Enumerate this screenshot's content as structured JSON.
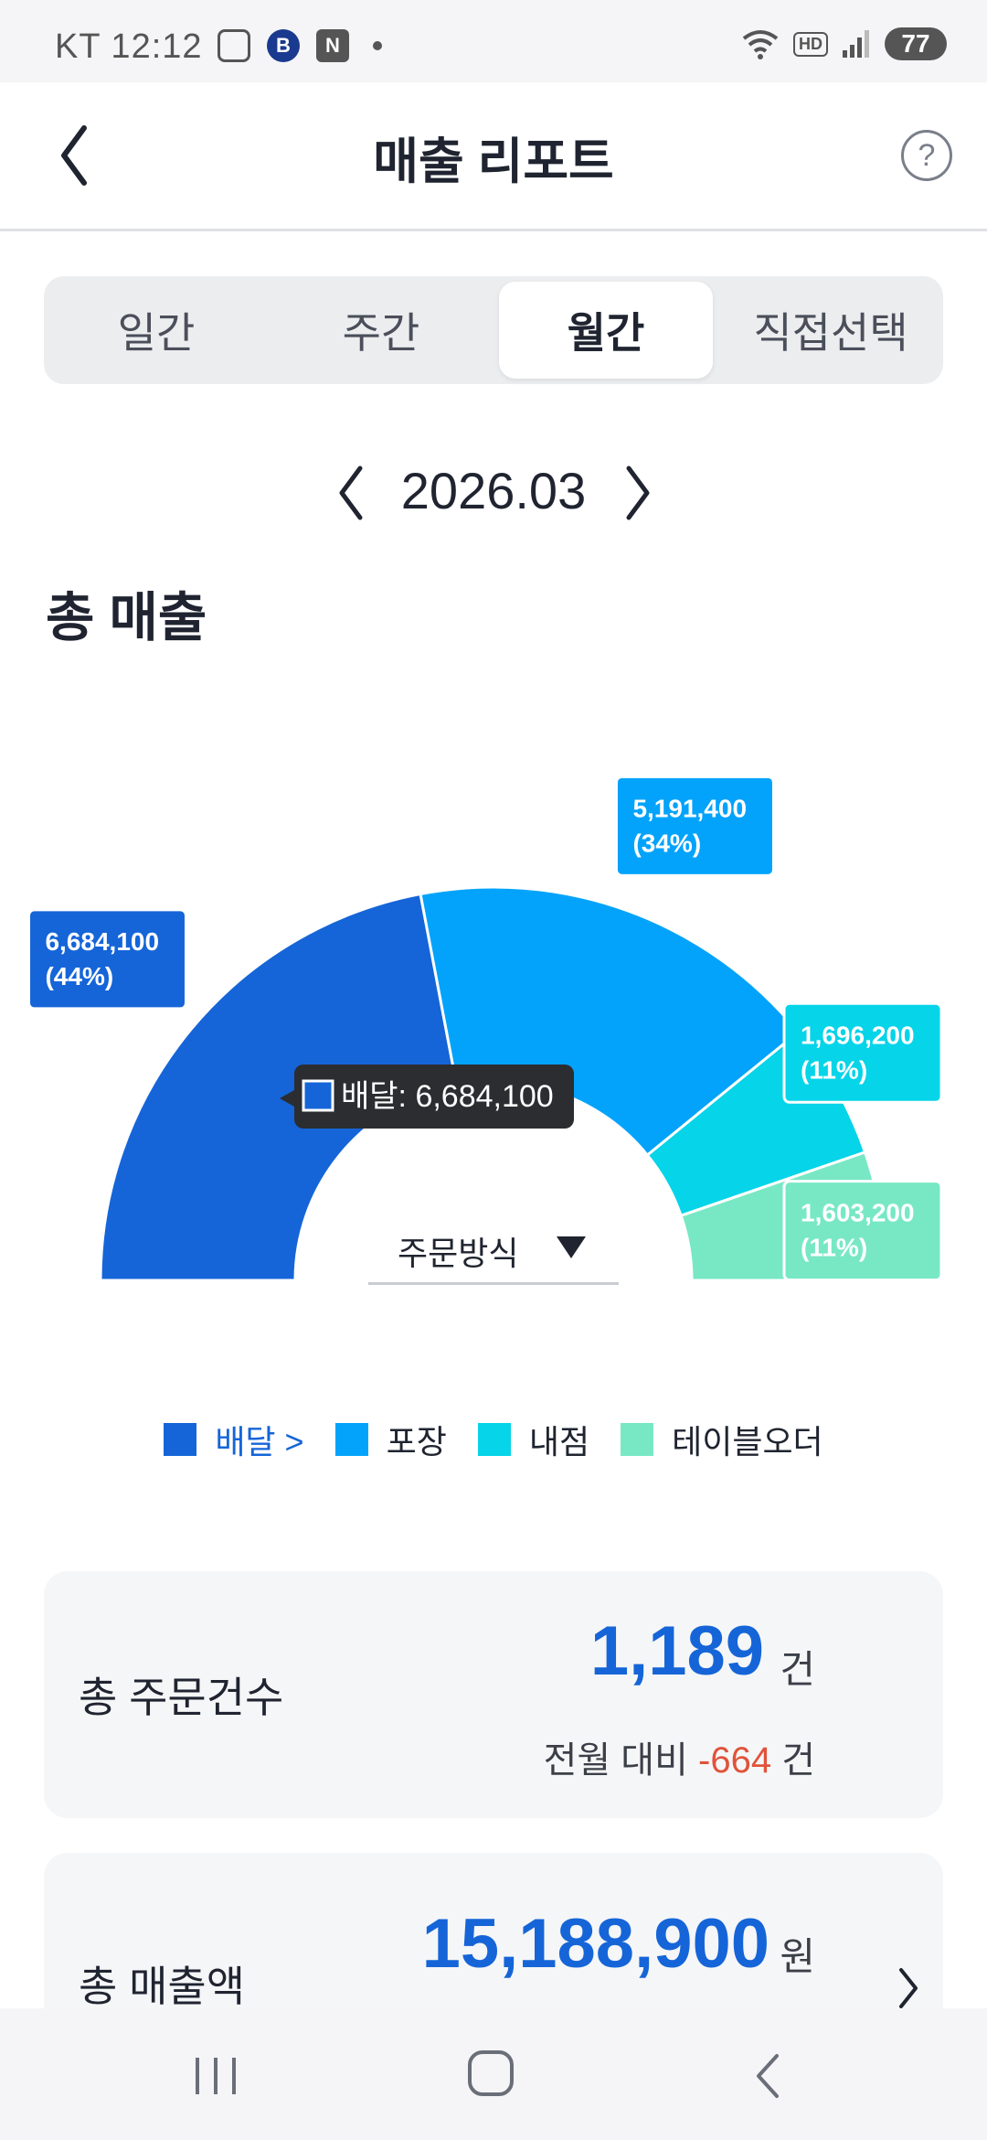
{
  "status_bar": {
    "carrier_time": "KT 12:12",
    "app_icon_text": "B",
    "n_icon_text": "N",
    "hd": "HD",
    "battery": "77"
  },
  "header": {
    "title": "매출 리포트",
    "help": "?"
  },
  "tabs": [
    {
      "label": "일간",
      "active": false
    },
    {
      "label": "주간",
      "active": false
    },
    {
      "label": "월간",
      "active": true
    },
    {
      "label": "직접선택",
      "active": false
    }
  ],
  "date": {
    "label": "2026.03"
  },
  "section_title": "총 매출",
  "chart_data": {
    "type": "pie",
    "categories": [
      "배달",
      "포장",
      "내점",
      "테이블오더"
    ],
    "values": [
      6684100,
      5191400,
      1696200,
      1603200
    ],
    "percent_labels": [
      "(44%)",
      "(34%)",
      "(11%)",
      "(11%)"
    ],
    "value_labels": [
      "6,684,100",
      "5,191,400",
      "1,696,200",
      "1,603,200"
    ],
    "colors": [
      "#1565d8",
      "#03a3fb",
      "#06d4e8",
      "#78e8c4"
    ],
    "tooltip": "배달: 6,684,100",
    "dropdown_label": "주문방식"
  },
  "legend": [
    {
      "label": "배달 >",
      "color": "#1565d8",
      "active": true
    },
    {
      "label": "포장",
      "color": "#03a3fb",
      "active": false
    },
    {
      "label": "내점",
      "color": "#06d4e8",
      "active": false
    },
    {
      "label": "테이블오더",
      "color": "#78e8c4",
      "active": false
    }
  ],
  "orders_card": {
    "label": "총 주문건수",
    "value": "1,189",
    "unit": "건",
    "compare_prefix": "전월 대비 ",
    "compare_value": "-664",
    "compare_unit": " 건"
  },
  "sales_card": {
    "label": "총 매출액",
    "value": "15,188,900",
    "unit": "원"
  }
}
